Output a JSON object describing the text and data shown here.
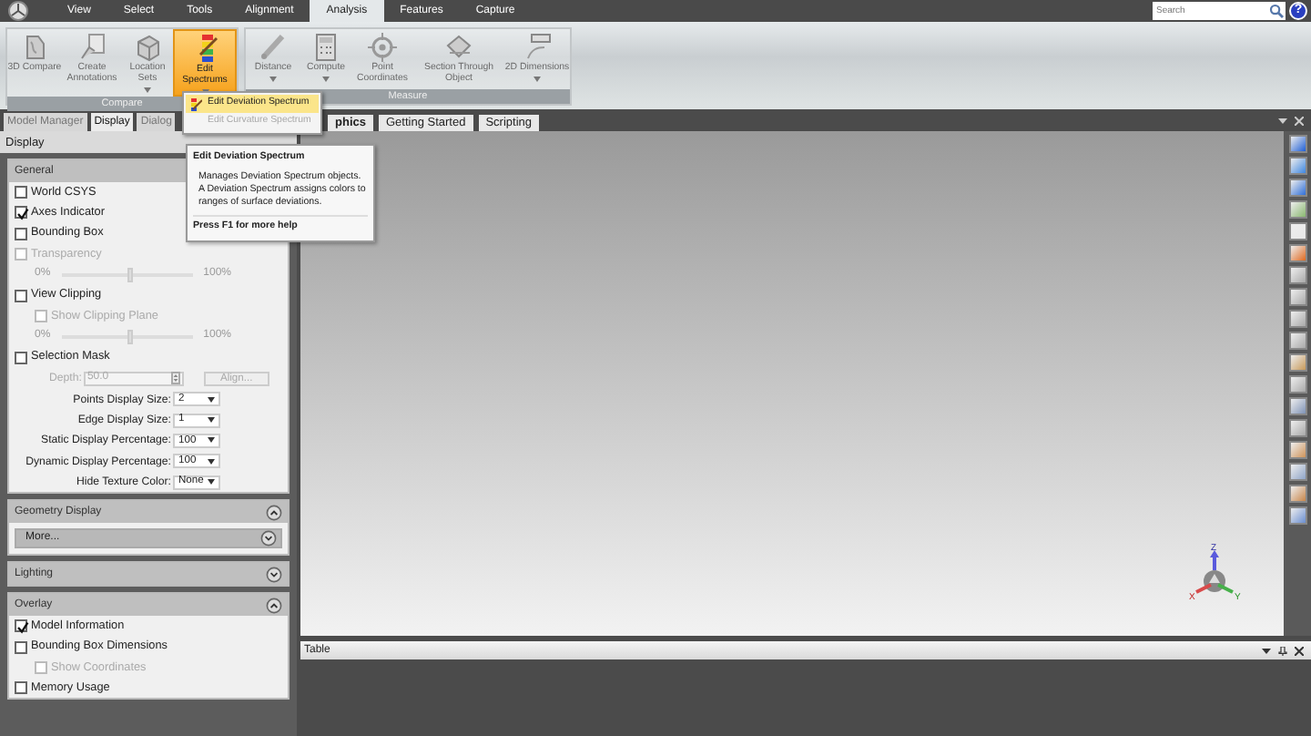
{
  "menu_tabs": [
    {
      "label": "View",
      "selected": false
    },
    {
      "label": "Select",
      "selected": false
    },
    {
      "label": "Tools",
      "selected": false
    },
    {
      "label": "Alignment",
      "selected": false
    },
    {
      "label": "Analysis",
      "selected": true
    },
    {
      "label": "Features",
      "selected": false
    },
    {
      "label": "Capture",
      "selected": false
    }
  ],
  "search": {
    "placeholder": "Search"
  },
  "help_button": "?",
  "ribbon_groups": [
    {
      "label": "Compare",
      "buttons": [
        {
          "label": "3D Compare",
          "dropdown": false,
          "highlighted": false
        },
        {
          "label": "Create Annotations",
          "dropdown": false,
          "highlighted": false
        },
        {
          "label": "Location Sets",
          "dropdown": true,
          "highlighted": false
        },
        {
          "label": "Edit Spectrums",
          "dropdown": true,
          "highlighted": true
        }
      ]
    },
    {
      "label": "Measure",
      "buttons": [
        {
          "label": "Distance",
          "dropdown": true,
          "highlighted": false
        },
        {
          "label": "Compute",
          "dropdown": true,
          "highlighted": false
        },
        {
          "label": "Point Coordinates",
          "dropdown": false,
          "highlighted": false
        },
        {
          "label": "Section Through Object",
          "dropdown": false,
          "highlighted": false
        },
        {
          "label": "2D Dimensions",
          "dropdown": true,
          "highlighted": false
        }
      ]
    }
  ],
  "dropdown_menu": [
    {
      "label": "Edit Deviation Spectrum",
      "disabled": false,
      "hovered": true
    },
    {
      "label": "Edit Curvature Spectrum",
      "disabled": true,
      "hovered": false
    }
  ],
  "tooltip": {
    "title": "Edit Deviation Spectrum",
    "body": "Manages Deviation Spectrum objects. A Deviation Spectrum assigns colors to ranges of surface deviations.",
    "footer": "Press F1 for more help"
  },
  "panel_tabs": [
    {
      "label": "Model Manager",
      "selected": false
    },
    {
      "label": "Display",
      "selected": true
    },
    {
      "label": "Dialog",
      "selected": false
    }
  ],
  "view_tabs": [
    {
      "label": "phics",
      "selected": true
    },
    {
      "label": "Getting Started",
      "selected": false
    },
    {
      "label": "Scripting",
      "selected": false
    }
  ],
  "display_panel": {
    "title": "Display",
    "sections": [
      {
        "title": "General",
        "items": [
          {
            "kind": "checkbox",
            "label": "World CSYS",
            "checked": false,
            "disabled": false
          },
          {
            "kind": "checkbox",
            "label": "Axes Indicator",
            "checked": true,
            "disabled": false
          },
          {
            "kind": "checkbox",
            "label": "Bounding Box",
            "checked": false,
            "disabled": false
          },
          {
            "kind": "checkbox",
            "label": "Transparency",
            "checked": false,
            "disabled": true
          },
          {
            "kind": "slider",
            "min": "0%",
            "max": "100%",
            "level": 0.5
          },
          {
            "kind": "checkbox",
            "label": "View Clipping",
            "checked": false,
            "disabled": false,
            "children": [
              {
                "kind": "checkbox",
                "label": "Show Clipping Plane",
                "checked": false,
                "disabled": true
              }
            ]
          },
          {
            "kind": "slider",
            "min": "0%",
            "max": "100%",
            "level": 0.5
          },
          {
            "kind": "checkbox",
            "label": "Selection Mask",
            "checked": false,
            "disabled": false
          },
          {
            "kind": "depth",
            "label": "Depth:",
            "value": "50.0",
            "button": "Align...",
            "disabled": true
          },
          {
            "kind": "select",
            "label": "Points Display Size:",
            "value": "2"
          },
          {
            "kind": "select",
            "label": "Edge Display Size:",
            "value": "1"
          },
          {
            "kind": "select",
            "label": "Static Display Percentage:",
            "value": "100"
          },
          {
            "kind": "select",
            "label": "Dynamic Display Percentage:",
            "value": "100"
          },
          {
            "kind": "select",
            "label": "Hide Texture Color:",
            "value": "None"
          }
        ]
      },
      {
        "title": "Geometry Display",
        "expanded": true,
        "items": [
          {
            "kind": "more",
            "label": "More..."
          }
        ]
      },
      {
        "title": "Lighting",
        "expanded": false
      },
      {
        "title": "Overlay",
        "expanded": true,
        "items": [
          {
            "kind": "checkbox",
            "label": "Model Information",
            "checked": true,
            "disabled": false
          },
          {
            "kind": "checkbox",
            "label": "Bounding Box Dimensions",
            "checked": false,
            "disabled": false,
            "children": [
              {
                "kind": "checkbox",
                "label": "Show Coordinates",
                "checked": false,
                "disabled": true
              }
            ]
          },
          {
            "kind": "checkbox",
            "label": "Memory Usage",
            "checked": false,
            "disabled": false
          }
        ]
      }
    ]
  },
  "axes": {
    "x": "X",
    "y": "Y",
    "z": "Z"
  },
  "table_panel": {
    "title": "Table"
  }
}
